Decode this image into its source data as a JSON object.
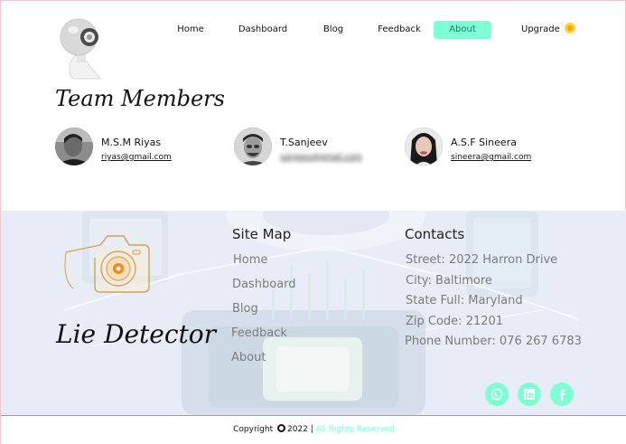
{
  "nav": {
    "items": [
      {
        "label": "Home"
      },
      {
        "label": "Dashboard"
      },
      {
        "label": "Blog"
      },
      {
        "label": "Feedback"
      },
      {
        "label": "About",
        "active": true
      },
      {
        "label": "Upgrade"
      }
    ]
  },
  "team": {
    "title": "Team Members",
    "members": [
      {
        "name": "M.S.M Riyas",
        "email": "riyas@gmail.com"
      },
      {
        "name": "T.Sanjeev",
        "email": "sanjeev@gmail.com"
      },
      {
        "name": "A.S.F Sineera",
        "email": "sineera@gmail.com"
      }
    ]
  },
  "footer": {
    "brand": "Lie Detector",
    "sitemap": {
      "title": "Site Map",
      "links": [
        "Home",
        "Dashboard",
        "Blog",
        "Feedback",
        "About"
      ]
    },
    "contacts": {
      "title": "Contacts",
      "lines": [
        "Street: 2022 Harron Drive",
        "City: Baltimore",
        "State Full: Maryland",
        "Zip Code: 21201",
        "Phone Number: 076 267 6783"
      ]
    },
    "social": [
      "whatsapp-icon",
      "linkedin-icon",
      "facebook-icon"
    ],
    "copyright": {
      "prefix": "Copyright",
      "year": "2022",
      "separator": "|",
      "rights": "All Rights Reserved"
    }
  },
  "colors": {
    "accent": "#7fffd4",
    "footer_bg": "#e7ecf6",
    "upgrade_badge": "#ffd23f"
  }
}
